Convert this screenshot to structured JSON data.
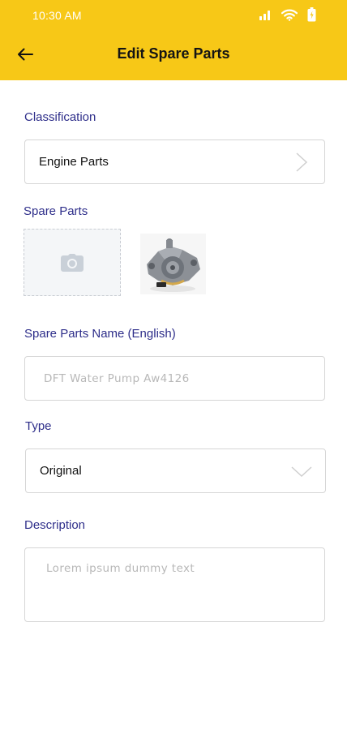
{
  "status_bar": {
    "time": "10:30 AM"
  },
  "header": {
    "title": "Edit Spare Parts",
    "background": "#F7C817"
  },
  "classification": {
    "label": "Classification",
    "value": "Engine Parts"
  },
  "spare_parts": {
    "label": "Spare Parts"
  },
  "name_en": {
    "label": "Spare Parts Name (English)",
    "placeholder": "DFT Water Pump Aw4126"
  },
  "type": {
    "label": "Type",
    "value": "Original"
  },
  "description": {
    "label": "Description",
    "placeholder": "Lorem ipsum dummy text"
  },
  "colors": {
    "label": "#2E2E8A",
    "border": "#D6D6D6",
    "placeholder": "#B8B8B8"
  }
}
